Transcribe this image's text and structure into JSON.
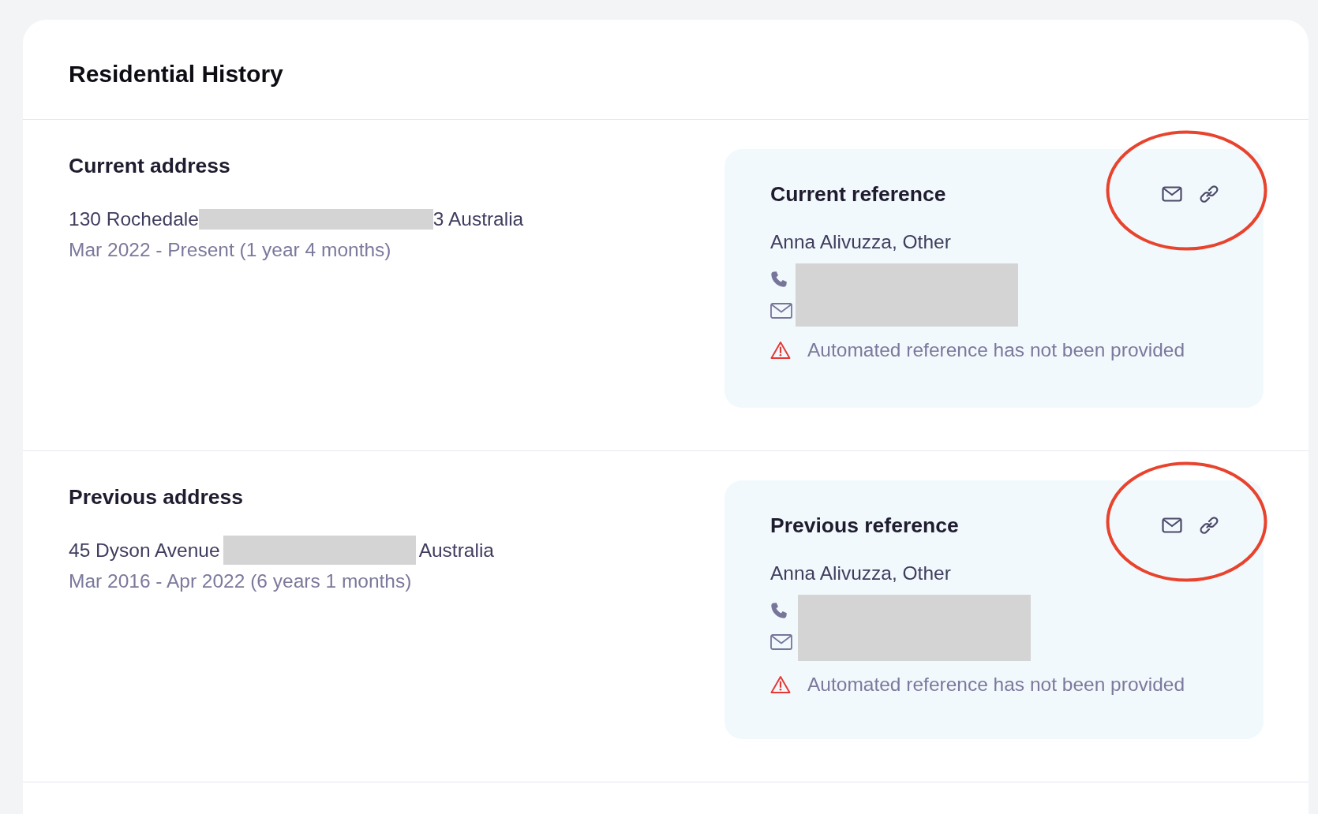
{
  "title": "Residential History",
  "sections": [
    {
      "heading": "Current address",
      "address_segments": [
        {
          "kind": "text",
          "text": "130 Rochedale"
        },
        {
          "kind": "redacted"
        },
        {
          "kind": "text",
          "text": "3 Australia"
        }
      ],
      "period": "Mar 2022 - Present (1 year 4 months)",
      "reference": {
        "title": "Current reference",
        "actions": [
          {
            "kind": "email"
          },
          {
            "kind": "link"
          }
        ],
        "circled": true,
        "referee": "Anna Alivuzza, Other",
        "contacts": [
          {
            "kind": "phone"
          },
          {
            "kind": "email"
          }
        ],
        "contacts_redacted": true,
        "warning": "Automated reference has not been provided"
      }
    },
    {
      "heading": "Previous address",
      "address_segments": [
        {
          "kind": "text",
          "text": "45 Dyson Avenue"
        },
        {
          "kind": "redacted"
        },
        {
          "kind": "text",
          "text": "Australia"
        }
      ],
      "period": "Mar 2016 - Apr 2022 (6 years 1 months)",
      "reference": {
        "title": "Previous reference",
        "actions": [
          {
            "kind": "email"
          },
          {
            "kind": "link"
          }
        ],
        "circled": true,
        "referee": "Anna Alivuzza, Other",
        "contacts": [
          {
            "kind": "phone"
          },
          {
            "kind": "email"
          }
        ],
        "contacts_redacted": true,
        "warning": "Automated reference has not been provided"
      }
    }
  ]
}
